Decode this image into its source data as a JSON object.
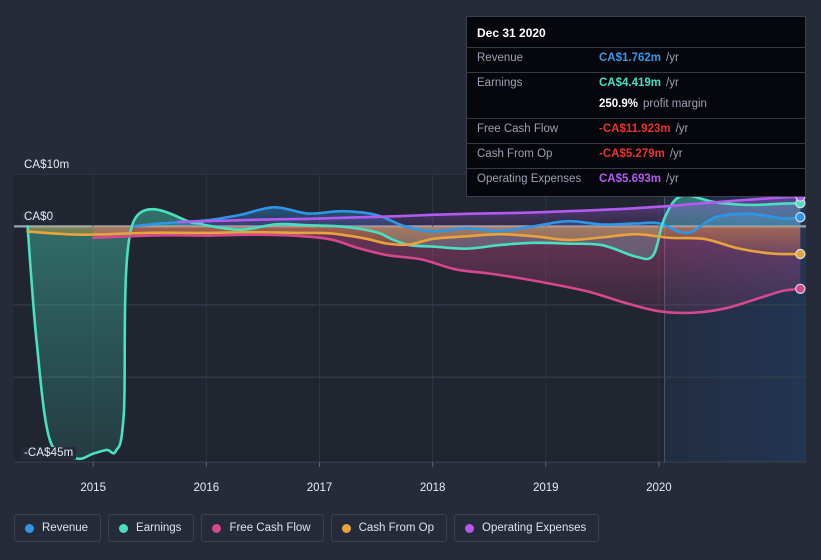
{
  "chart_data": {
    "type": "line",
    "title": "",
    "xlabel": "",
    "ylabel": "",
    "currency": "CA$",
    "grid": true,
    "legend_position": "bottom",
    "xlim": [
      2014.3,
      2021.3
    ],
    "ylim": [
      -45,
      10
    ],
    "x_ticks": [
      "2015",
      "2016",
      "2017",
      "2018",
      "2019",
      "2020"
    ],
    "x_tick_values": [
      2015,
      2016,
      2017,
      2018,
      2019,
      2020
    ],
    "y_ticks": [
      "CA$10m",
      "CA$0",
      "-CA$45m"
    ],
    "y_tick_values": [
      10,
      0,
      -45
    ],
    "gridline_values": [
      10,
      0,
      -15,
      -28.8
    ],
    "forecast_band_start": 2020.05,
    "series": [
      {
        "name": "Revenue",
        "color": "#2e96e8",
        "end_value": 1.762,
        "x": [
          2015.35,
          2015.6,
          2016.0,
          2016.3,
          2016.6,
          2016.9,
          2017.2,
          2017.5,
          2017.75,
          2018.0,
          2018.3,
          2018.6,
          2018.9,
          2019.2,
          2019.5,
          2019.8,
          2020.0,
          2020.25,
          2020.5,
          2020.8,
          2021.1,
          2021.25
        ],
        "values": [
          0.0,
          0.55,
          1.15,
          2.2,
          3.65,
          2.45,
          2.9,
          2.2,
          0.05,
          -0.95,
          -0.4,
          -0.9,
          0.05,
          1.0,
          0.35,
          0.55,
          0.6,
          -1.25,
          1.75,
          2.4,
          1.5,
          1.762
        ]
      },
      {
        "name": "Earnings",
        "color": "#49dfc0",
        "end_value": 4.419,
        "x": [
          2014.42,
          2014.5,
          2014.62,
          2014.85,
          2015.0,
          2015.12,
          2015.2,
          2015.27,
          2015.35,
          2015.9,
          2016.0,
          2016.3,
          2016.62,
          2016.9,
          2017.2,
          2017.5,
          2017.65,
          2017.8,
          2018.0,
          2018.3,
          2018.6,
          2018.9,
          2019.2,
          2019.5,
          2019.8,
          2019.95,
          2020.05,
          2020.2,
          2020.5,
          2020.8,
          2021.1,
          2021.25
        ],
        "values": [
          0.0,
          -22.0,
          -41.0,
          -44.3,
          -43.4,
          -42.7,
          -42.9,
          -36.0,
          0.55,
          0.6,
          0.2,
          -0.65,
          0.4,
          0.2,
          -0.05,
          -1.1,
          -2.55,
          -3.6,
          -3.85,
          -4.25,
          -3.55,
          -3.15,
          -3.3,
          -3.6,
          -5.8,
          -5.5,
          1.6,
          5.8,
          4.6,
          4.1,
          4.35,
          4.419
        ]
      },
      {
        "name": "Free Cash Flow",
        "color": "#d6478f",
        "end_value": -11.923,
        "x": [
          2015.0,
          2015.3,
          2015.6,
          2016.0,
          2016.4,
          2016.8,
          2017.1,
          2017.35,
          2017.6,
          2017.9,
          2018.2,
          2018.5,
          2018.8,
          2019.1,
          2019.4,
          2019.7,
          2020.0,
          2020.3,
          2020.6,
          2020.9,
          2021.1,
          2021.25
        ],
        "values": [
          -2.2,
          -1.9,
          -1.7,
          -1.75,
          -1.6,
          -1.8,
          -2.5,
          -4.2,
          -5.5,
          -6.3,
          -8.2,
          -9.0,
          -10.0,
          -11.2,
          -12.6,
          -14.6,
          -16.2,
          -16.5,
          -15.6,
          -13.6,
          -12.3,
          -11.923
        ]
      },
      {
        "name": "Cash From Op",
        "color": "#e8a33d",
        "end_value": -5.279,
        "x": [
          2014.42,
          2014.8,
          2015.05,
          2015.3,
          2015.6,
          2016.0,
          2016.4,
          2016.8,
          2017.1,
          2017.4,
          2017.6,
          2017.8,
          2018.0,
          2018.3,
          2018.6,
          2018.9,
          2019.2,
          2019.5,
          2019.8,
          2020.1,
          2020.4,
          2020.7,
          2021.0,
          2021.25
        ],
        "values": [
          -1.0,
          -1.55,
          -1.55,
          -1.35,
          -1.2,
          -1.25,
          -1.1,
          -1.25,
          -1.35,
          -2.3,
          -3.3,
          -3.45,
          -2.4,
          -1.9,
          -1.5,
          -1.9,
          -2.6,
          -2.1,
          -1.5,
          -2.2,
          -2.4,
          -4.2,
          -5.2,
          -5.279
        ]
      },
      {
        "name": "Operating Expenses",
        "color": "#b35bf0",
        "end_value": 5.693,
        "x": [
          2015.75,
          2016.1,
          2016.5,
          2016.9,
          2017.3,
          2017.7,
          2018.0,
          2018.4,
          2018.8,
          2019.2,
          2019.6,
          2020.0,
          2020.4,
          2020.8,
          2021.1,
          2021.25
        ],
        "values": [
          0.85,
          1.05,
          1.3,
          1.45,
          1.7,
          1.95,
          2.2,
          2.45,
          2.6,
          2.9,
          3.25,
          3.75,
          4.45,
          5.1,
          5.55,
          5.693
        ]
      }
    ]
  },
  "tooltip": {
    "title": "Dec 31 2020",
    "rows": [
      {
        "key": "Revenue",
        "value": "CA$1.762m",
        "suffix": "/yr",
        "color_class": "v-rev"
      },
      {
        "key": "Earnings",
        "value": "CA$4.419m",
        "suffix": "/yr",
        "color_class": "v-earn"
      },
      {
        "key": "",
        "value": "250.9%",
        "suffix": "profit margin",
        "color_class": "v-wht"
      },
      {
        "key": "Free Cash Flow",
        "value": "-CA$11.923m",
        "suffix": "/yr",
        "color_class": "v-neg"
      },
      {
        "key": "Cash From Op",
        "value": "-CA$5.279m",
        "suffix": "/yr",
        "color_class": "v-neg"
      },
      {
        "key": "Operating Expenses",
        "value": "CA$5.693m",
        "suffix": "/yr",
        "color_class": "v-opex"
      }
    ]
  },
  "legend": {
    "items": [
      {
        "label": "Revenue",
        "color": "#2e96e8"
      },
      {
        "label": "Earnings",
        "color": "#49dfc0"
      },
      {
        "label": "Free Cash Flow",
        "color": "#d6478f"
      },
      {
        "label": "Cash From Op",
        "color": "#e8a33d"
      },
      {
        "label": "Operating Expenses",
        "color": "#b35bf0"
      }
    ]
  },
  "axes": {
    "y_labels": [
      {
        "text": "CA$10m",
        "value": 10
      },
      {
        "text": "CA$0",
        "value": 0
      },
      {
        "text": "-CA$45m",
        "value": -45
      }
    ],
    "x_labels": [
      "2015",
      "2016",
      "2017",
      "2018",
      "2019",
      "2020"
    ]
  }
}
